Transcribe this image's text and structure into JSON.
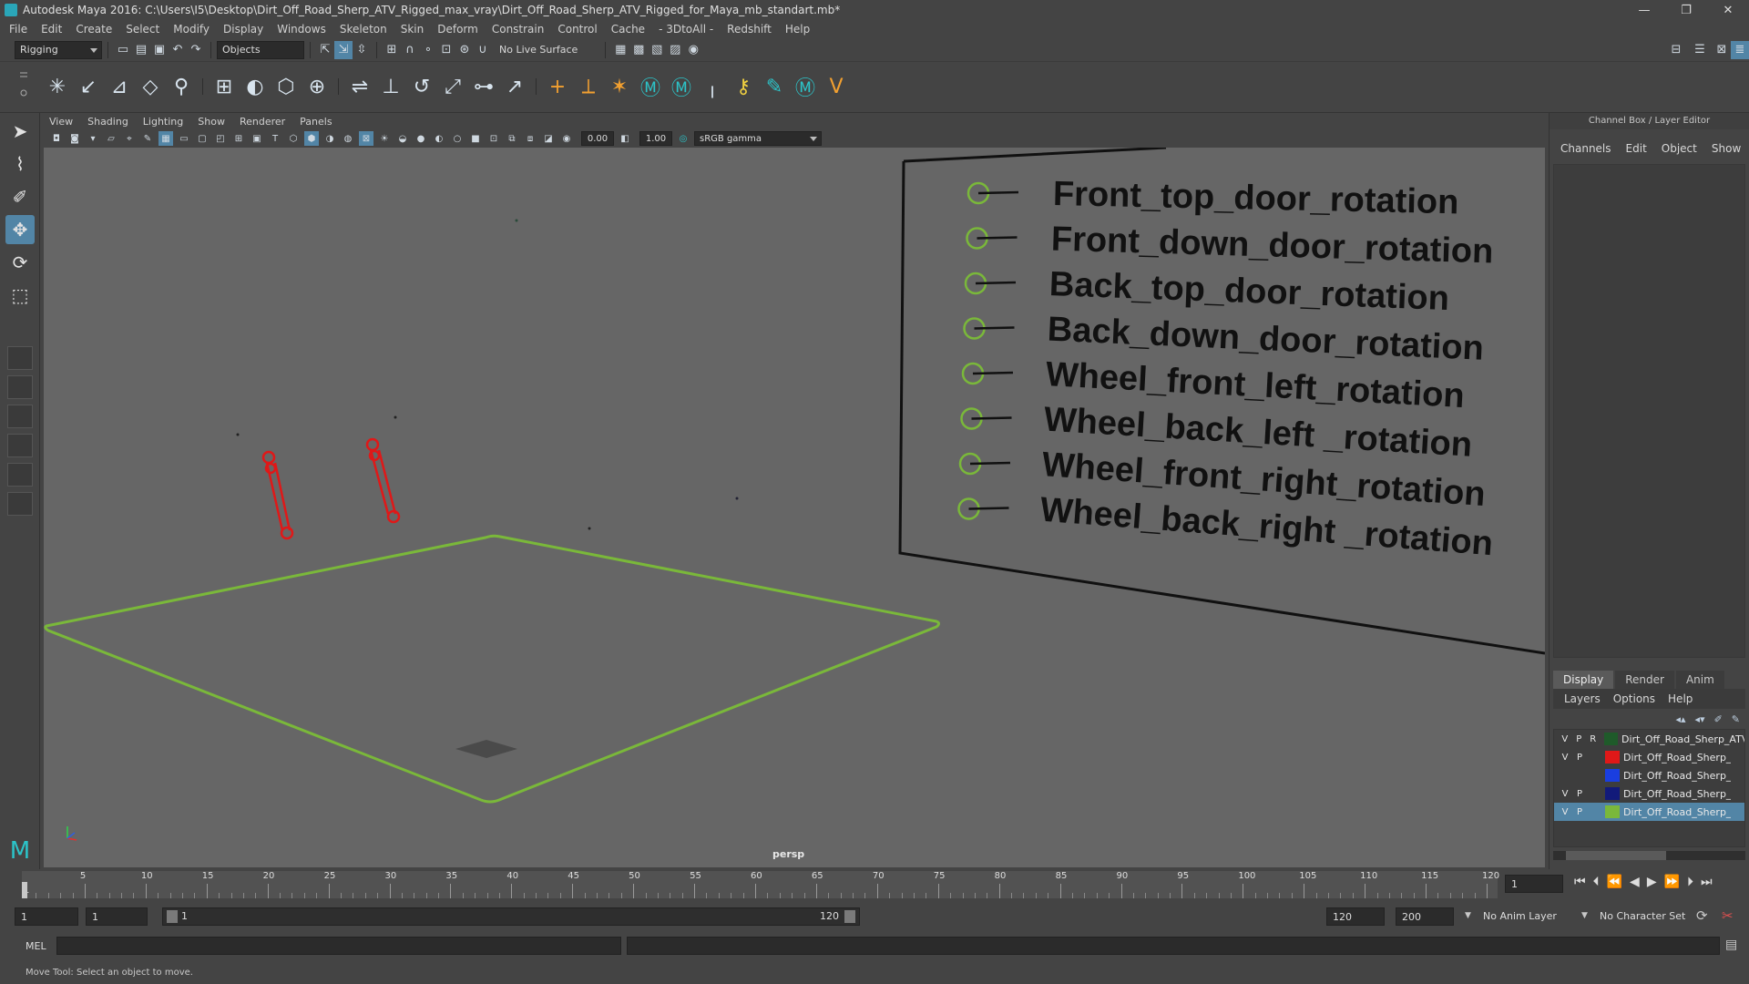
{
  "window": {
    "title": "Autodesk Maya 2016: C:\\Users\\I5\\Desktop\\Dirt_Off_Road_Sherp_ATV_Rigged_max_vray\\Dirt_Off_Road_Sherp_ATV_Rigged_for_Maya_mb_standart.mb*",
    "minimize": "—",
    "maximize": "❐",
    "close": "✕"
  },
  "menus": [
    "File",
    "Edit",
    "Create",
    "Select",
    "Modify",
    "Display",
    "Windows",
    "Skeleton",
    "Skin",
    "Deform",
    "Constrain",
    "Control",
    "Cache",
    "- 3DtoAll -",
    "Redshift",
    "Help"
  ],
  "statusline": {
    "mode": "Rigging",
    "select_mode": "Objects",
    "live_surface": "No Live Surface"
  },
  "panel": {
    "menus": [
      "View",
      "Shading",
      "Lighting",
      "Show",
      "Renderer",
      "Panels"
    ],
    "exposure": "0.00",
    "gamma": "1.00",
    "colorspace": "sRGB gamma",
    "camera_label": "persp"
  },
  "viewport": {
    "control_labels": [
      "Front_top_door_rotation",
      "Front_down_door_rotation",
      "Back_top_door_rotation",
      "Back_down_door_rotation",
      "Wheel_front_left_rotation",
      "Wheel_back_left _rotation",
      "Wheel_front_right_rotation",
      "Wheel_back_right _rotation"
    ]
  },
  "channelbox": {
    "header": "Channel Box / Layer Editor",
    "menus": [
      "Channels",
      "Edit",
      "Object",
      "Show"
    ]
  },
  "layers": {
    "tabs": [
      "Display",
      "Render",
      "Anim"
    ],
    "menus": [
      "Layers",
      "Options",
      "Help"
    ],
    "rows": [
      {
        "v": "V",
        "p": "P",
        "r": "R",
        "color": "#1f5a2a",
        "name": "Dirt_Off_Road_Sherp_ATV"
      },
      {
        "v": "V",
        "p": "P",
        "r": "",
        "color": "#e01818",
        "name": "Dirt_Off_Road_Sherp_"
      },
      {
        "v": "",
        "p": "",
        "r": "",
        "color": "#1a3ee0",
        "name": "Dirt_Off_Road_Sherp_"
      },
      {
        "v": "V",
        "p": "P",
        "r": "",
        "color": "#121a7a",
        "name": "Dirt_Off_Road_Sherp_"
      },
      {
        "v": "V",
        "p": "P",
        "r": "",
        "color": "#7ab83a",
        "name": "Dirt_Off_Road_Sherp_"
      }
    ]
  },
  "timeline": {
    "ticks": [
      "5",
      "10",
      "15",
      "20",
      "25",
      "30",
      "35",
      "40",
      "45",
      "50",
      "55",
      "60",
      "65",
      "70",
      "75",
      "80",
      "85",
      "90",
      "95",
      "100",
      "105",
      "110",
      "115",
      "120"
    ],
    "start_tick": "1",
    "current_frame": "1"
  },
  "range": {
    "start": "1",
    "playback_start": "1",
    "slider_start": "1",
    "slider_end": "120",
    "playback_end": "120",
    "end": "200",
    "anim_layer": "No Anim Layer",
    "character_set": "No Character Set"
  },
  "command": {
    "label": "MEL"
  },
  "help": {
    "text": "Move Tool: Select an object to move."
  },
  "colors": {
    "accent": "#5285a6",
    "viewport_bg": "#666666",
    "ui_bg": "#444444",
    "ground_curve": "#7ab83a",
    "rig_red": "#e01818"
  }
}
